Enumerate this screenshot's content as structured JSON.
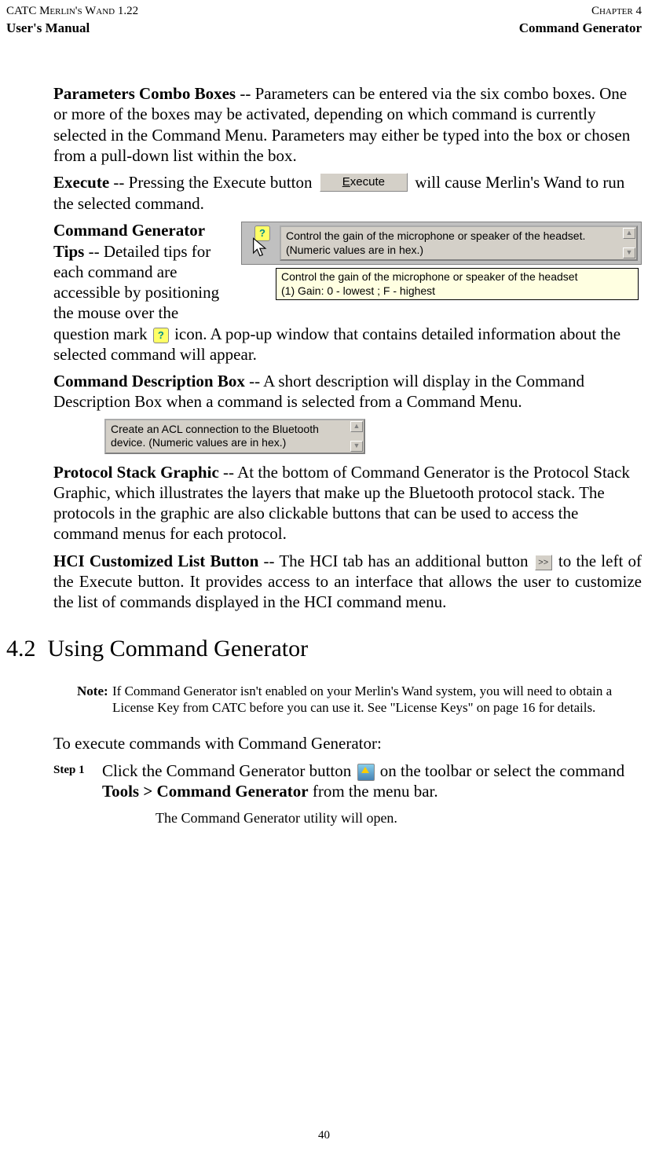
{
  "header": {
    "product": "CATC Merlin's Wand 1.22",
    "chapter": "Chapter 4",
    "manual": "User's Manual",
    "section_title": "Command Generator"
  },
  "paragraphs": {
    "combo_boxes_label": "Parameters Combo Boxes",
    "combo_boxes_text": " -- Parameters can be entered via the six combo boxes. One or more of the boxes may be activated, depending on which command is currently selected in the Command Menu. Parameters may either be typed into the box or chosen from a pull-down list within the box.",
    "execute_label": "Execute",
    "execute_before": " -- Pressing the Execute button ",
    "execute_btn_text": "Execute",
    "execute_after": " will cause Merlin's Wand to run the selected command.",
    "tips_label": "Command Generator Tips",
    "tips_before": " -- Detailed tips for each command are accessible by positioning the mouse over the question mark ",
    "tips_after": " icon. A pop-up window that contains detailed information about the selected command will appear.",
    "tip_box_line1": "Control the gain of the microphone or speaker of the headset. (Numeric values are in hex.)",
    "tip_tooltip_line1": "Control the gain of the microphone or speaker of the headset",
    "tip_tooltip_line2": "(1) Gain: 0 - lowest ; F - highest",
    "desc_label": "Command Description Box",
    "desc_text": " -- A short description will display in the Command Description Box when a command is selected from a Command Menu.",
    "desc_box_text": "Create an ACL connection to the Bluetooth device. (Numeric values are in hex.)",
    "stack_label": "Protocol Stack Graphic",
    "stack_text": " -- At the bottom of Command Generator is the Protocol Stack Graphic, which illustrates the layers that make up the Bluetooth protocol stack. The protocols in the graphic are also clickable buttons that can be used to access the command menus for each protocol.",
    "hci_label": "HCI Customized List Button",
    "hci_before": " -- The HCI tab has an additional button ",
    "hci_more": ">>",
    "hci_after": " to the left of the Execute button. It provides access to an interface that allows the user to customize the list of commands displayed in the HCI command menu."
  },
  "section": {
    "number": "4.2",
    "title": "Using Command Generator"
  },
  "note": {
    "label": "Note",
    "text": "If Command Generator isn't enabled on your Merlin's Wand system, you will need to obtain a License Key from CATC before you can use it. See \"License Keys\" on page 16 for details."
  },
  "intro": "To execute commands with Command Generator:",
  "step1": {
    "label": "Step 1",
    "before": "Click the Command Generator button ",
    "after_icon": " on the toolbar or select the command ",
    "menu_path": "Tools > Command Generator",
    "after_menu": " from the menu bar.",
    "result": "The Command Generator utility will open."
  },
  "footer": {
    "page_number": "40"
  },
  "icons": {
    "question_mark": "?",
    "scroll_up": "▲",
    "scroll_down": "▼"
  }
}
